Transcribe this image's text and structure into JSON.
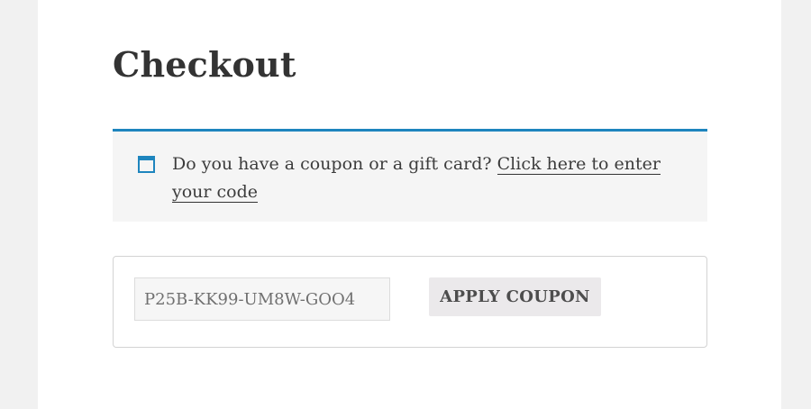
{
  "page": {
    "title": "Checkout"
  },
  "notice": {
    "icon": "window-icon",
    "accent_color": "#1e85be",
    "text": "Do you have a coupon or a gift card? ",
    "link_text": "Click here to enter your code"
  },
  "coupon": {
    "input_value": "P25B-KK99-UM8W-GOO4",
    "apply_label": "APPLY COUPON"
  }
}
